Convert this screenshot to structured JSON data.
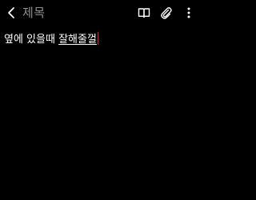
{
  "header": {
    "back_icon": "chevron-left-icon",
    "title_placeholder": "제목",
    "actions": [
      {
        "name": "reader-mode",
        "icon": "open-book-icon"
      },
      {
        "name": "attach",
        "icon": "paperclip-icon"
      },
      {
        "name": "more",
        "icon": "vertical-dots-icon"
      }
    ]
  },
  "editor": {
    "committed_text": "옆에 있을때 ",
    "composing_text": "잘해줄껄",
    "text_color": "#ffffff",
    "caret_color": "#e01e3c"
  },
  "colors": {
    "background": "#000000",
    "title_placeholder": "#8f8f8f",
    "icons": "#ffffff"
  }
}
